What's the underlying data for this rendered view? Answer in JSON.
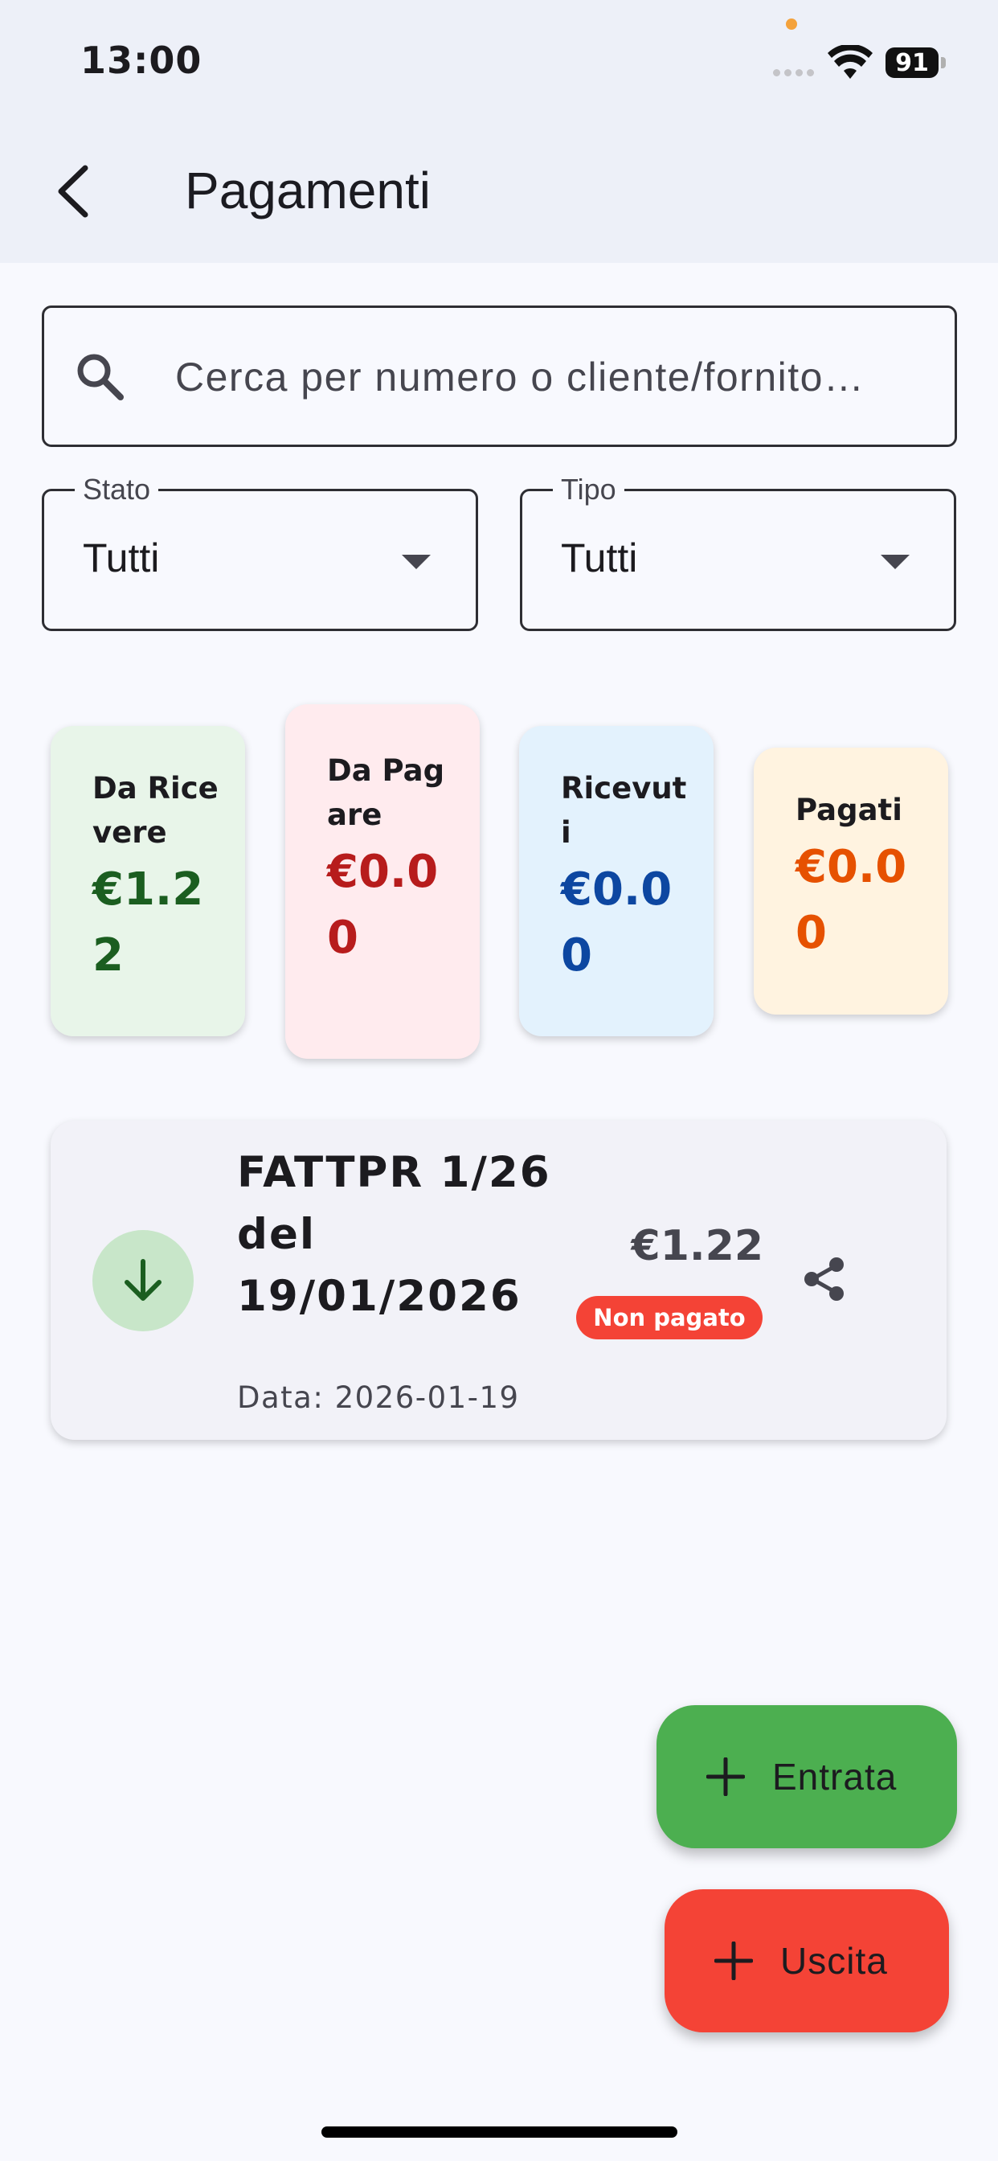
{
  "status_bar": {
    "time": "13:00",
    "battery": "91"
  },
  "app_bar": {
    "title": "Pagamenti",
    "back_icon": "chevron-left-icon"
  },
  "search": {
    "placeholder": "Cerca per numero o cliente/fornito…",
    "value": "",
    "icon": "search-icon"
  },
  "filters": [
    {
      "label": "Stato",
      "value": "Tutti"
    },
    {
      "label": "Tipo",
      "value": "Tutti"
    }
  ],
  "summary_cards": [
    {
      "label": "Da Ricevere",
      "value": "€1.22",
      "bg": "#e8f5e9",
      "color": "#1b5e20"
    },
    {
      "label": "Da Pagare",
      "value": "€0.00",
      "bg": "#ffebee",
      "color": "#b71c1c"
    },
    {
      "label": "Ricevuti",
      "value": "€0.00",
      "bg": "#e3f2fd",
      "color": "#0d47a1"
    },
    {
      "label": "Pagati",
      "value": "€0.00",
      "bg": "#fff3e0",
      "color": "#e65100"
    }
  ],
  "payments": [
    {
      "title": "FATTPR 1/26 del 19/01/2026",
      "amount": "€1.22",
      "status": "Non pagato",
      "date": "Data: 2026-01-19",
      "direction_icon": "arrow-down-icon",
      "share_icon": "share-icon"
    }
  ],
  "fabs": {
    "income": {
      "label": "Entrata",
      "color": "#4caf50",
      "icon": "plus-icon"
    },
    "expense": {
      "label": "Uscita",
      "color": "#f44336",
      "icon": "plus-icon"
    }
  }
}
